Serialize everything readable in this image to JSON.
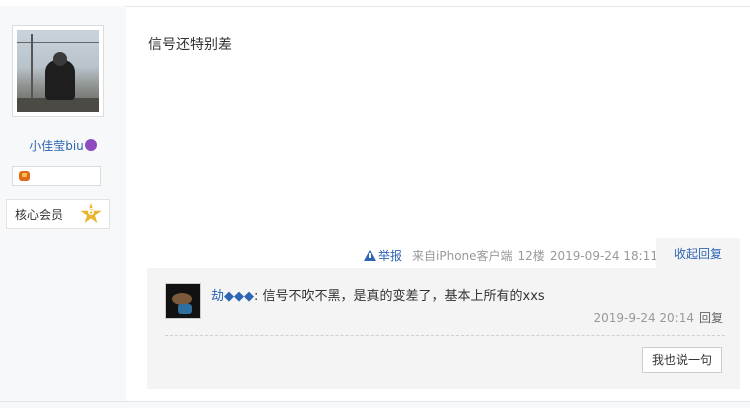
{
  "author": {
    "name": "小佳莹biu",
    "emoji_icon": "smiling-devil-icon",
    "badge_icon": "medal-icon",
    "member_label": "核心会员",
    "level": "6"
  },
  "post": {
    "text": "信号还特别差",
    "report_label": "举报",
    "source": "来自iPhone客户端",
    "floor": "12楼",
    "datetime": "2019-09-24 18:11",
    "collapse_label": "收起回复"
  },
  "reply": {
    "user": "劫◆◆◆",
    "separator": ": ",
    "text": "信号不吹不黑，是真的变差了，基本上所有的xxs",
    "datetime": "2019-9-24 20:14",
    "reply_label": "回复"
  },
  "actions": {
    "say_label": "我也说一句"
  },
  "colors": {
    "link": "#2d64b3",
    "sidebar_bg": "#f7f8fa",
    "reply_bg": "#f4f4f5"
  }
}
